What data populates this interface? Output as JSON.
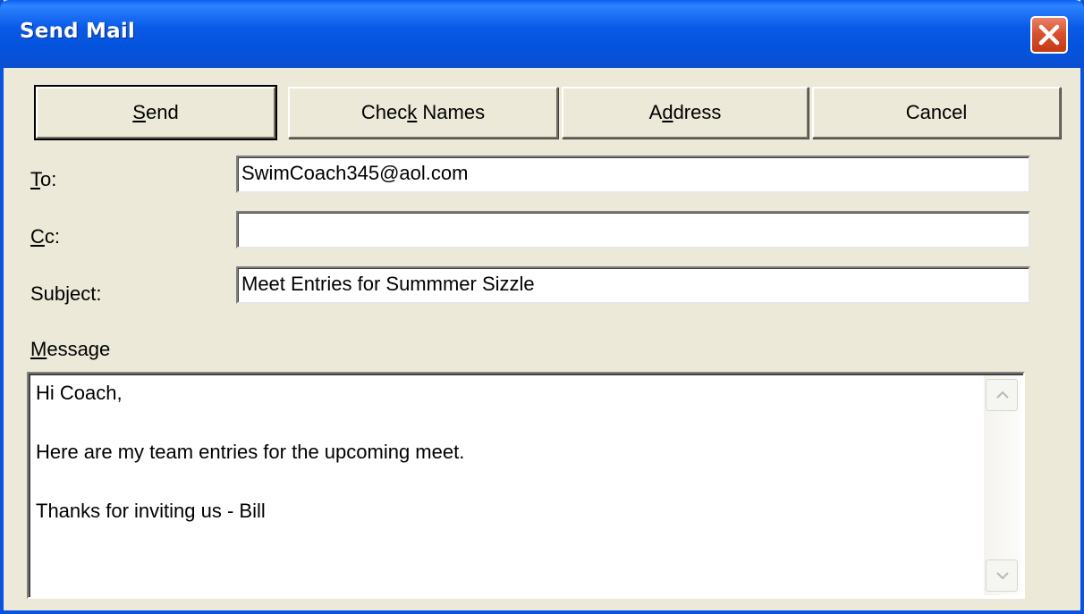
{
  "window": {
    "title": "Send Mail"
  },
  "toolbar": {
    "send": {
      "pre": "",
      "accel": "S",
      "post": "end"
    },
    "check_names": {
      "pre": "Chec",
      "accel": "k",
      "post": " Names"
    },
    "address": {
      "pre": "A",
      "accel": "d",
      "post": "dress"
    },
    "cancel": {
      "pre": "Cancel",
      "accel": "",
      "post": ""
    }
  },
  "fields": {
    "to": {
      "label_accel": "T",
      "label_rest": "o:",
      "value": "SwimCoach345@aol.com"
    },
    "cc": {
      "label_accel": "C",
      "label_rest": "c:",
      "value": ""
    },
    "subject": {
      "label_pre": "Sub",
      "label_accel": "j",
      "label_post": "ect:",
      "value": "Meet Entries for Summmer Sizzle"
    }
  },
  "message": {
    "label_accel": "M",
    "label_rest": "essage",
    "lines": [
      "Hi Coach,",
      "",
      "Here are my team entries for the upcoming meet.",
      "",
      "Thanks for inviting us - Bill"
    ]
  },
  "colors": {
    "titlebar": "#0a5ae8",
    "dialog_bg": "#ece9d8",
    "close_button": "#d9522e"
  },
  "icons": {
    "close": "close-icon",
    "scroll_up": "chevron-up-icon",
    "scroll_down": "chevron-down-icon"
  }
}
